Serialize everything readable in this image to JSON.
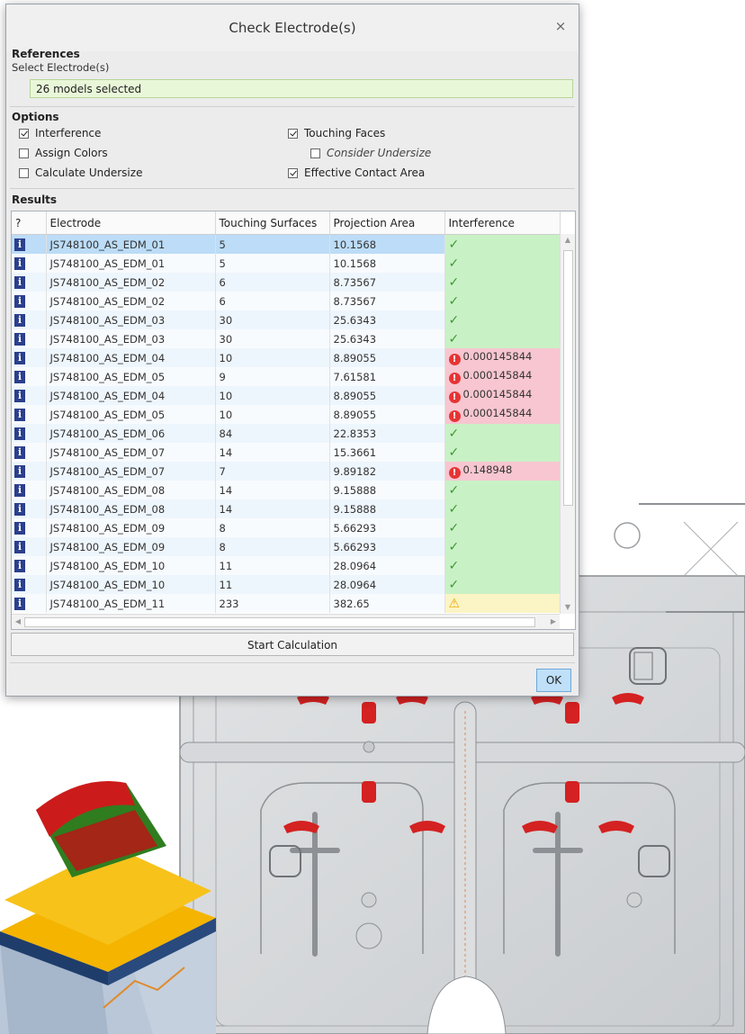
{
  "dialog": {
    "title": "Check Electrode(s)",
    "close_glyph": "×"
  },
  "references": {
    "heading": "References",
    "select_label": "Select Electrode(s)",
    "selection_value": "26 models selected"
  },
  "options": {
    "heading": "Options",
    "interference": {
      "label": "Interference",
      "checked": true
    },
    "assign_colors": {
      "label": "Assign Colors",
      "checked": false
    },
    "calculate_undersize": {
      "label": "Calculate Undersize",
      "checked": false
    },
    "touching_faces": {
      "label": "Touching Faces",
      "checked": true
    },
    "consider_undersize": {
      "label": "Consider Undersize",
      "checked": false
    },
    "effective_contact_area": {
      "label": "Effective Contact Area",
      "checked": true
    }
  },
  "results": {
    "heading": "Results",
    "columns": [
      "?",
      "Electrode",
      "Touching Surfaces",
      "Projection Area",
      "Interference"
    ],
    "info_glyph": "i",
    "rows": [
      {
        "electrode": "JS748100_AS_EDM_01",
        "touching": "5",
        "area": "10.1568",
        "status": "ok",
        "interference": ""
      },
      {
        "electrode": "JS748100_AS_EDM_01",
        "touching": "5",
        "area": "10.1568",
        "status": "ok",
        "interference": ""
      },
      {
        "electrode": "JS748100_AS_EDM_02",
        "touching": "6",
        "area": "8.73567",
        "status": "ok",
        "interference": ""
      },
      {
        "electrode": "JS748100_AS_EDM_02",
        "touching": "6",
        "area": "8.73567",
        "status": "ok",
        "interference": ""
      },
      {
        "electrode": "JS748100_AS_EDM_03",
        "touching": "30",
        "area": "25.6343",
        "status": "ok",
        "interference": ""
      },
      {
        "electrode": "JS748100_AS_EDM_03",
        "touching": "30",
        "area": "25.6343",
        "status": "ok",
        "interference": ""
      },
      {
        "electrode": "JS748100_AS_EDM_04",
        "touching": "10",
        "area": "8.89055",
        "status": "error",
        "interference": "0.000145844"
      },
      {
        "electrode": "JS748100_AS_EDM_05",
        "touching": "9",
        "area": "7.61581",
        "status": "error",
        "interference": "0.000145844"
      },
      {
        "electrode": "JS748100_AS_EDM_04",
        "touching": "10",
        "area": "8.89055",
        "status": "error",
        "interference": "0.000145844"
      },
      {
        "electrode": "JS748100_AS_EDM_05",
        "touching": "10",
        "area": "8.89055",
        "status": "error",
        "interference": "0.000145844"
      },
      {
        "electrode": "JS748100_AS_EDM_06",
        "touching": "84",
        "area": "22.8353",
        "status": "ok",
        "interference": ""
      },
      {
        "electrode": "JS748100_AS_EDM_07",
        "touching": "14",
        "area": "15.3661",
        "status": "ok",
        "interference": ""
      },
      {
        "electrode": "JS748100_AS_EDM_07",
        "touching": "7",
        "area": "9.89182",
        "status": "error",
        "interference": "0.148948"
      },
      {
        "electrode": "JS748100_AS_EDM_08",
        "touching": "14",
        "area": "9.15888",
        "status": "ok",
        "interference": ""
      },
      {
        "electrode": "JS748100_AS_EDM_08",
        "touching": "14",
        "area": "9.15888",
        "status": "ok",
        "interference": ""
      },
      {
        "electrode": "JS748100_AS_EDM_09",
        "touching": "8",
        "area": "5.66293",
        "status": "ok",
        "interference": ""
      },
      {
        "electrode": "JS748100_AS_EDM_09",
        "touching": "8",
        "area": "5.66293",
        "status": "ok",
        "interference": ""
      },
      {
        "electrode": "JS748100_AS_EDM_10",
        "touching": "11",
        "area": "28.0964",
        "status": "ok",
        "interference": ""
      },
      {
        "electrode": "JS748100_AS_EDM_10",
        "touching": "11",
        "area": "28.0964",
        "status": "ok",
        "interference": ""
      },
      {
        "electrode": "JS748100_AS_EDM_11",
        "touching": "233",
        "area": "382.65",
        "status": "warning",
        "interference": ""
      }
    ],
    "selected_row": 0
  },
  "buttons": {
    "start_calculation": "Start Calculation",
    "ok": "OK"
  },
  "colors": {
    "ok_fill": "#c9f1c6",
    "error_fill": "#f7c6d0",
    "warning_fill": "#fbf4c4",
    "selected_row": "#bcdcf7",
    "info_badge": "#2b3f8c"
  }
}
